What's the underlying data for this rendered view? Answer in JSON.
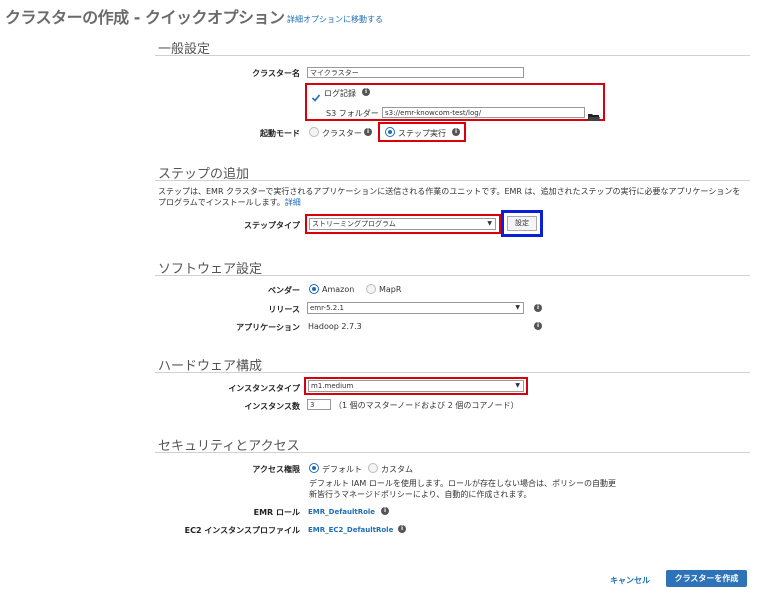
{
  "header": {
    "title": "クラスターの作成 - クイックオプション",
    "advanced_link": "詳細オプションに移動する"
  },
  "general": {
    "heading": "一般設定",
    "cluster_name_label": "クラスター名",
    "cluster_name_value": "マイクラスター",
    "logging_label": "ログ記録",
    "logging_checked": true,
    "s3_folder_label": "S3 フォルダー",
    "s3_folder_value": "s3://emr-knowcom-test/log/",
    "launch_mode_label": "起動モード",
    "launch_mode_options": [
      "クラスター",
      "ステップ実行"
    ],
    "launch_mode_selected": "ステップ実行"
  },
  "steps": {
    "heading": "ステップの追加",
    "description": "ステップは、EMR クラスターで実行されるアプリケーションに送信される作業のユニットです。EMR は、追加されたステップの実行に必要なアプリケーションをプログラムでインストールします。",
    "detail_link": "詳細",
    "step_type_label": "ステップタイプ",
    "step_type_value": "ストリーミングプログラム",
    "configure_button": "設定"
  },
  "software": {
    "heading": "ソフトウェア設定",
    "vendor_label": "ベンダー",
    "vendor_options": [
      "Amazon",
      "MapR"
    ],
    "vendor_selected": "Amazon",
    "release_label": "リリース",
    "release_value": "emr-5.2.1",
    "applications_label": "アプリケーション",
    "applications_value": "Hadoop 2.7.3"
  },
  "hardware": {
    "heading": "ハードウェア構成",
    "instance_type_label": "インスタンスタイプ",
    "instance_type_value": "m1.medium",
    "instance_count_label": "インスタンス数",
    "instance_count_value": "3",
    "instance_count_note": "（1 個のマスターノードおよび 2 個のコアノード）"
  },
  "security": {
    "heading": "セキュリティとアクセス",
    "permissions_label": "アクセス権限",
    "permissions_options": [
      "デフォルト",
      "カスタム"
    ],
    "permissions_selected": "デフォルト",
    "permissions_note_line1": "デフォルト IAM ロールを使用します。ロールが存在しない場合は、ポリシーの自動更",
    "permissions_note_line2": "新皆行うマネージドポリシーにより、自動的に作成されます。",
    "emr_role_label": "EMR ロール",
    "emr_role_value": "EMR_DefaultRole",
    "ec2_profile_label": "EC2 インスタンスプロファイル",
    "ec2_profile_value": "EMR_EC2_DefaultRole"
  },
  "footer": {
    "cancel_label": "キャンセル",
    "create_label": "クラスターを作成"
  },
  "colors": {
    "accent": "#1f6eb5",
    "highlight_red": "#d9000b",
    "highlight_blue": "#0b1fd6",
    "primary_button": "#2e73b8"
  },
  "icons": [
    "info-icon",
    "folder-icon",
    "checkbox-checked-icon",
    "dropdown-arrow-icon"
  ]
}
